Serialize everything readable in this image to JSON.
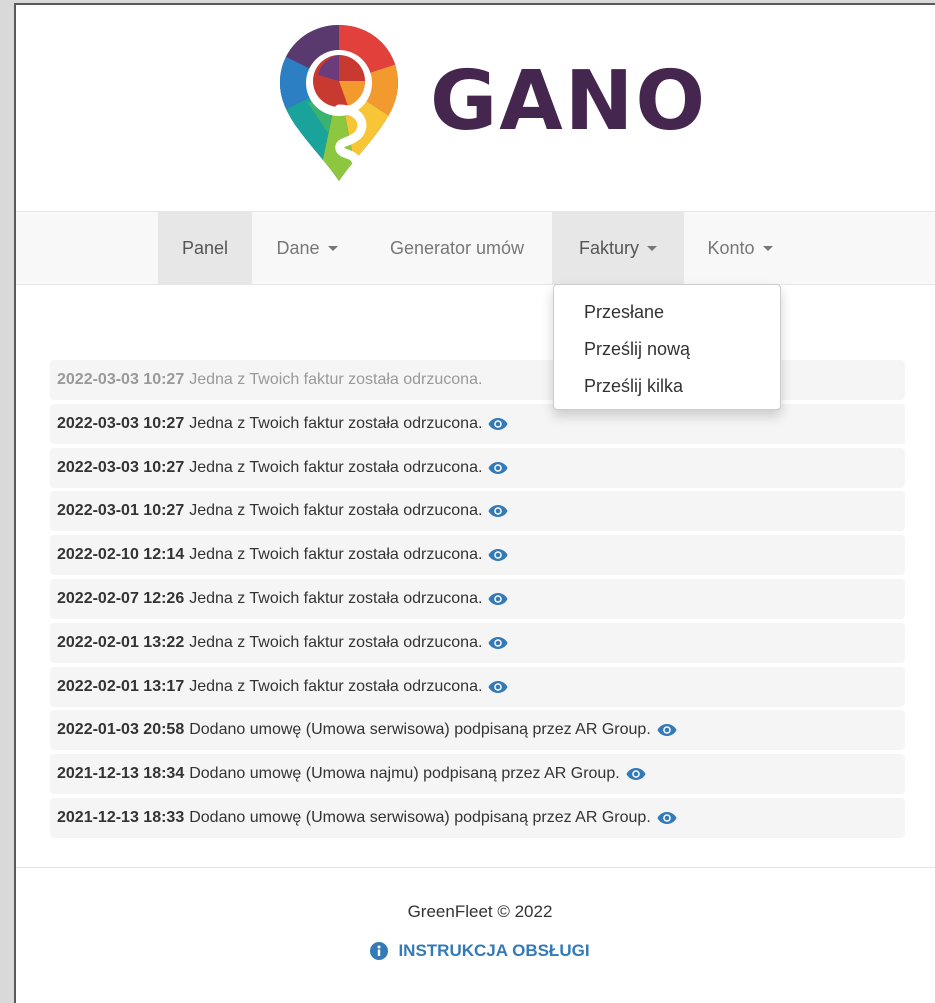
{
  "brand": {
    "name": "GANO",
    "text_color": "#45264e"
  },
  "nav": {
    "items": [
      {
        "label": "Panel",
        "has_caret": false,
        "state": "active"
      },
      {
        "label": "Dane",
        "has_caret": true,
        "state": ""
      },
      {
        "label": "Generator umów",
        "has_caret": false,
        "state": ""
      },
      {
        "label": "Faktury",
        "has_caret": true,
        "state": "open"
      },
      {
        "label": "Konto",
        "has_caret": true,
        "state": ""
      }
    ]
  },
  "dropdown": {
    "items": [
      "Przesłane",
      "Prześlij nową",
      "Prześlij kilka"
    ]
  },
  "notifications": [
    {
      "timestamp": "2022-03-03 10:27",
      "message": "Jedna z Twoich faktur została odrzucona.",
      "faded": true
    },
    {
      "timestamp": "2022-03-03 10:27",
      "message": "Jedna z Twoich faktur została odrzucona.",
      "faded": false
    },
    {
      "timestamp": "2022-03-03 10:27",
      "message": "Jedna z Twoich faktur została odrzucona.",
      "faded": false
    },
    {
      "timestamp": "2022-03-01 10:27",
      "message": "Jedna z Twoich faktur została odrzucona.",
      "faded": false
    },
    {
      "timestamp": "2022-02-10 12:14",
      "message": "Jedna z Twoich faktur została odrzucona.",
      "faded": false
    },
    {
      "timestamp": "2022-02-07 12:26",
      "message": "Jedna z Twoich faktur została odrzucona.",
      "faded": false
    },
    {
      "timestamp": "2022-02-01 13:22",
      "message": "Jedna z Twoich faktur została odrzucona.",
      "faded": false
    },
    {
      "timestamp": "2022-02-01 13:17",
      "message": "Jedna z Twoich faktur została odrzucona.",
      "faded": false
    },
    {
      "timestamp": "2022-01-03 20:58",
      "message": "Dodano umowę (Umowa serwisowa) podpisaną przez AR Group.",
      "faded": false
    },
    {
      "timestamp": "2021-12-13 18:34",
      "message": "Dodano umowę (Umowa najmu) podpisaną przez AR Group.",
      "faded": false
    },
    {
      "timestamp": "2021-12-13 18:33",
      "message": "Dodano umowę (Umowa serwisowa) podpisaną przez AR Group.",
      "faded": false
    }
  ],
  "footer": {
    "copyright": "GreenFleet © 2022",
    "manual_label": "INSTRUKCJA OBSŁUGI"
  },
  "icons": {
    "view": "eye-icon",
    "info": "info-circle-icon"
  },
  "colors": {
    "link": "#337ab7",
    "nav_active_bg": "#e7e7e7",
    "navbar_bg": "#f8f8f8",
    "row_bg": "#f5f5f5"
  }
}
